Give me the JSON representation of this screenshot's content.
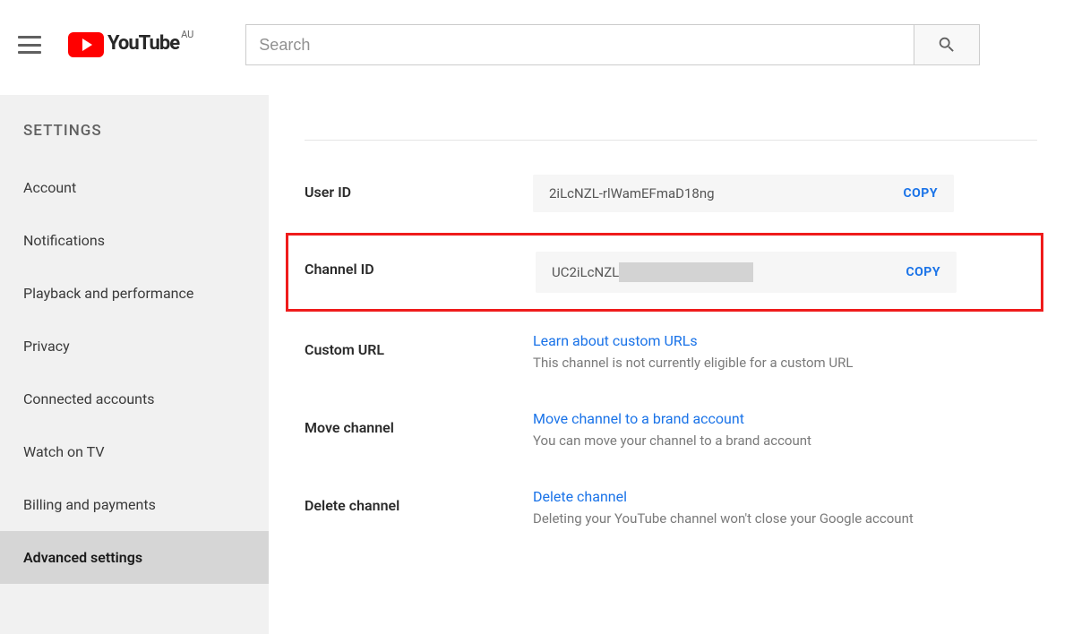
{
  "header": {
    "brand_word": "YouTube",
    "region": "AU",
    "search_placeholder": "Search"
  },
  "sidebar": {
    "title": "SETTINGS",
    "items": [
      {
        "label": "Account"
      },
      {
        "label": "Notifications"
      },
      {
        "label": "Playback and performance"
      },
      {
        "label": "Privacy"
      },
      {
        "label": "Connected accounts"
      },
      {
        "label": "Watch on TV"
      },
      {
        "label": "Billing and payments"
      },
      {
        "label": "Advanced settings"
      }
    ],
    "active_index": 7
  },
  "main": {
    "user_id": {
      "label": "User ID",
      "value": "2iLcNZL-rlWamEFmaD18ng",
      "copy_label": "COPY"
    },
    "channel_id": {
      "label": "Channel ID",
      "value": "UC2iLcNZL",
      "copy_label": "COPY"
    },
    "custom_url": {
      "label": "Custom URL",
      "link_text": "Learn about custom URLs",
      "desc": "This channel is not currently eligible for a custom URL"
    },
    "move_channel": {
      "label": "Move channel",
      "link_text": "Move channel to a brand account",
      "desc": "You can move your channel to a brand account"
    },
    "delete_channel": {
      "label": "Delete channel",
      "link_text": "Delete channel",
      "desc": "Deleting your YouTube channel won't close your Google account"
    }
  }
}
